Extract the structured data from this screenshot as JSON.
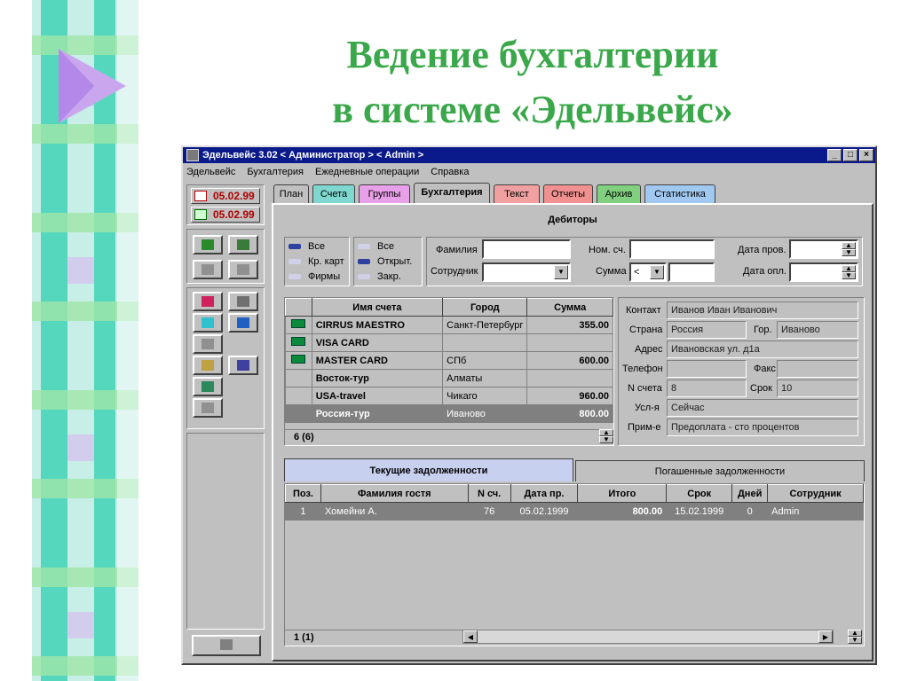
{
  "slide": {
    "title_line1": "Ведение бухгалтерии",
    "title_line2": "в системе «Эдельвейс»",
    "title_color": "#3aa84a"
  },
  "window": {
    "title": "Эдельвейс 3.02 < Администратор > < Admin >",
    "menu": [
      "Эдельвейс",
      "Бухгалтерия",
      "Ежедневные операции",
      "Справка"
    ],
    "controls": [
      "_",
      "□",
      "×"
    ]
  },
  "left_panel": {
    "date1": "05.02.99",
    "date2": "05.02.99"
  },
  "tabs": [
    {
      "label": "План",
      "color": "#c0c0c0"
    },
    {
      "label": "Счета",
      "color": "#7fd8d0"
    },
    {
      "label": "Группы",
      "color": "#e8a0e8"
    },
    {
      "label": "Бухгалтерия",
      "color": "#c0c0c0",
      "active": true
    },
    {
      "label": "Текст",
      "color": "#f0a0a0"
    },
    {
      "label": "Отчеты",
      "color": "#f09090"
    },
    {
      "label": "Архив",
      "color": "#80d080"
    },
    {
      "label": "Статистика",
      "color": "#a0c8f0"
    }
  ],
  "debtors": {
    "title": "Дебиторы",
    "filter1": [
      "Все",
      "Кр. карт",
      "Фирмы"
    ],
    "filter2": [
      "Все",
      "Открыт.",
      "Закр."
    ],
    "labels": {
      "surname": "Фамилия",
      "employee": "Сотрудник",
      "account_no": "Ном. сч.",
      "sum": "Сумма",
      "check_date": "Дата пров.",
      "pay_date": "Дата опл."
    },
    "sum_operator": "<"
  },
  "accounts_table": {
    "headers": [
      "Имя счета",
      "Город",
      "Сумма"
    ],
    "rows": [
      {
        "name": "CIRRUS MAESTRO",
        "city": "Санкт-Петербург",
        "sum": "355.00",
        "icon": true
      },
      {
        "name": "VISA CARD",
        "city": "",
        "sum": "",
        "icon": true
      },
      {
        "name": "MASTER CARD",
        "city": "СПб",
        "sum": "600.00",
        "icon": true
      },
      {
        "name": "Восток-тур",
        "city": "Алматы",
        "sum": "",
        "icon": false
      },
      {
        "name": "USA-travel",
        "city": "Чикаго",
        "sum": "960.00",
        "icon": false
      },
      {
        "name": "Россия-тур",
        "city": "Иваново",
        "sum": "800.00",
        "icon": false,
        "selected": true
      }
    ],
    "status": "6 (6)"
  },
  "contact": {
    "contact_label": "Контакт",
    "contact": "Иванов Иван Иванович",
    "country_label": "Страна",
    "country": "Россия",
    "city_label": "Гор.",
    "city": "Иваново",
    "address_label": "Адрес",
    "address": "Ивановская ул. д1а",
    "phone_label": "Телефон",
    "phone": "",
    "fax_label": "Факс",
    "fax": "",
    "account_label": "N счета",
    "account": "8",
    "term_label": "Срок",
    "term": "10",
    "conditions_label": "Усл-я",
    "conditions": "Сейчас",
    "note_label": "Прим-е",
    "note": "Предоплата - сто процентов"
  },
  "debts": {
    "tab_current": "Текущие задолженности",
    "tab_paid": "Погашенные задолженности",
    "headers": [
      "Поз.",
      "Фамилия гостя",
      "N сч.",
      "Дата пр.",
      "Итого",
      "Срок",
      "Дней",
      "Сотрудник"
    ],
    "rows": [
      {
        "pos": "1",
        "guest": "Хомейни А.",
        "account": "76",
        "date": "05.02.1999",
        "total": "800.00",
        "term": "15.02.1999",
        "days": "0",
        "employee": "Admin"
      }
    ],
    "status": "1 (1)"
  }
}
